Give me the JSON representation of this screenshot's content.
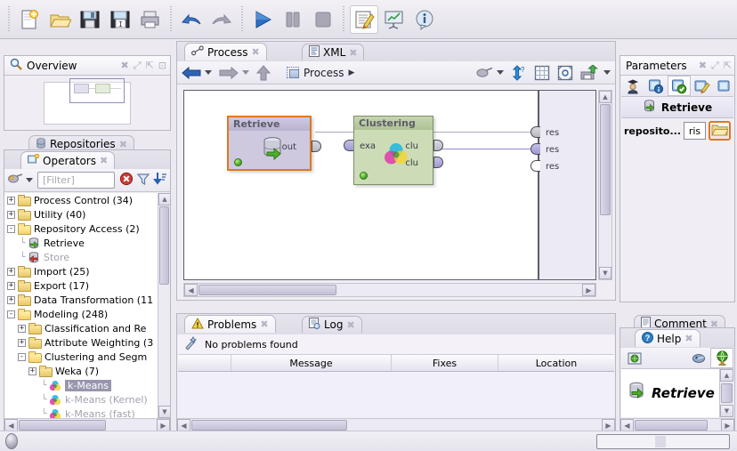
{
  "toolbar": {
    "groups": [
      {
        "buttons": [
          {
            "name": "new-process-button",
            "icon": "new-document-icon",
            "label": "New"
          },
          {
            "name": "open-process-button",
            "icon": "open-folder-icon",
            "label": "Open"
          },
          {
            "name": "save-button",
            "icon": "save-disk-icon",
            "label": "Save"
          },
          {
            "name": "save-as-button",
            "icon": "save-as-disk-icon",
            "label": "Save As"
          },
          {
            "name": "print-button",
            "icon": "printer-icon",
            "label": "Print"
          }
        ]
      },
      {
        "buttons": [
          {
            "name": "undo-button",
            "icon": "undo-arrow-icon",
            "label": "Undo"
          },
          {
            "name": "redo-button",
            "icon": "redo-arrow-icon",
            "label": "Redo"
          }
        ]
      },
      {
        "buttons": [
          {
            "name": "run-button",
            "icon": "play-triangle-icon",
            "label": "Run"
          },
          {
            "name": "pause-button",
            "icon": "pause-bars-icon",
            "label": "Pause"
          },
          {
            "name": "stop-button",
            "icon": "stop-square-icon",
            "label": "Stop"
          }
        ]
      },
      {
        "buttons": [
          {
            "name": "design-perspective-button",
            "icon": "notepad-pencil-icon",
            "label": "Design",
            "selected": true
          },
          {
            "name": "results-perspective-button",
            "icon": "chart-easel-icon",
            "label": "Results",
            "selected": false
          },
          {
            "name": "info-button",
            "icon": "info-balloon-icon",
            "label": "Info",
            "selected": false
          }
        ]
      }
    ]
  },
  "overview": {
    "tab_label": "Overview",
    "icon": "magnifier-icon",
    "header_buttons": [
      "close-icon",
      "maximize-icon",
      "dock-icon",
      "restore-icon"
    ]
  },
  "repositories": {
    "tab_label": "Repositories",
    "icon": "database-icon",
    "close": "close-icon"
  },
  "operators": {
    "tab_label": "Operators",
    "icon": "operators-icon",
    "close": "close-icon",
    "filter_placeholder": "[Filter]",
    "filter_value": "",
    "toolbar_icons": [
      "operator-group-icon",
      "chevron-down-icon",
      "clear-filter-icon",
      "funnel-filter-icon",
      "sort-descending-icon"
    ],
    "tree": [
      {
        "label": "Process Control (34)",
        "depth": 0,
        "type": "folder",
        "toggle": "+"
      },
      {
        "label": "Utility (40)",
        "depth": 0,
        "type": "folder",
        "toggle": "+"
      },
      {
        "label": "Repository Access (2)",
        "depth": 0,
        "type": "folder-open",
        "toggle": "-"
      },
      {
        "label": "Retrieve",
        "depth": 1,
        "type": "operator-retrieve",
        "toggle": ""
      },
      {
        "label": "Store",
        "depth": 1,
        "type": "operator-store",
        "toggle": "",
        "dim": true
      },
      {
        "label": "Import (25)",
        "depth": 0,
        "type": "folder",
        "toggle": "+"
      },
      {
        "label": "Export (17)",
        "depth": 0,
        "type": "folder",
        "toggle": "+"
      },
      {
        "label": "Data Transformation (11",
        "depth": 0,
        "type": "folder",
        "toggle": "+"
      },
      {
        "label": "Modeling (248)",
        "depth": 0,
        "type": "folder-open",
        "toggle": "-"
      },
      {
        "label": "Classification and Re",
        "depth": 1,
        "type": "folder",
        "toggle": "+"
      },
      {
        "label": "Attribute Weighting (3",
        "depth": 1,
        "type": "folder",
        "toggle": "+"
      },
      {
        "label": "Clustering and Segm",
        "depth": 1,
        "type": "folder-open",
        "toggle": "-"
      },
      {
        "label": "Weka (7)",
        "depth": 2,
        "type": "folder",
        "toggle": "+"
      },
      {
        "label": "k-Means",
        "depth": 3,
        "type": "operator-kmeans",
        "toggle": "",
        "selected": true
      },
      {
        "label": "k-Means (Kernel)",
        "depth": 3,
        "type": "operator-kmeans",
        "toggle": "",
        "dim": true
      },
      {
        "label": "k-Means (fast)",
        "depth": 3,
        "type": "operator-kmeans",
        "toggle": "",
        "dim": true
      }
    ]
  },
  "process": {
    "tabs": [
      {
        "label": "Process",
        "icon": "process-link-icon",
        "active": true,
        "close": "close-icon"
      },
      {
        "label": "XML",
        "icon": "xml-document-icon",
        "active": false,
        "close": "close-icon"
      }
    ],
    "toolbar": {
      "back_icon": "back-arrow-icon",
      "back_caret": "chevron-down-icon",
      "forward_icon": "forward-arrow-icon",
      "forward_caret": "chevron-down-icon",
      "up_icon": "up-arrow-icon",
      "breadcrumb_icon": "process-root-icon",
      "breadcrumb_label": "Process",
      "breadcrumb_caret": "chevron-right-icon",
      "right_icons": [
        "filter-view-icon",
        "chevron-down-icon",
        "auto-layout-icon",
        "grid-icon",
        "fit-to-screen-icon",
        "export-image-icon",
        "chevron-down-icon"
      ]
    },
    "operators": [
      {
        "name": "Retrieve",
        "selected": true,
        "icon": "retrieve-database-icon",
        "status": "ready",
        "header_color": "#bfb9d4",
        "body_color": "#cfc9e0",
        "border_color": "#e07820",
        "output_ports": [
          {
            "label": "out",
            "state": "gray"
          }
        ],
        "input_ports": []
      },
      {
        "name": "Clustering",
        "selected": false,
        "icon": "kmeans-cluster-icon",
        "status": "ready",
        "header_color": "#b9c9a4",
        "body_color": "#cbdcb6",
        "border_color": "#7e8f68",
        "input_ports": [
          {
            "label": "exa",
            "state": "violet"
          }
        ],
        "output_ports": [
          {
            "label": "clu",
            "state": "gray"
          },
          {
            "label": "clu",
            "state": "violet"
          }
        ]
      }
    ],
    "result_ports": [
      {
        "label": "res",
        "state": "gray"
      },
      {
        "label": "res",
        "state": "violet"
      },
      {
        "label": "res",
        "state": "empty"
      }
    ]
  },
  "problems": {
    "tabs": [
      {
        "label": "Problems",
        "icon": "warning-triangle-icon",
        "active": true,
        "close": "close-icon"
      },
      {
        "label": "Log",
        "icon": "log-document-icon",
        "active": false,
        "close": "close-icon"
      }
    ],
    "status_icon": "quickfix-wand-icon",
    "status_text": "No problems found",
    "columns": [
      "Message",
      "Fixes",
      "Location"
    ],
    "rows": []
  },
  "parameters": {
    "tab_label": "Parameters",
    "icon": "parameters-icon",
    "header_buttons": [
      "close-icon",
      "maximize-icon",
      "dock-icon"
    ],
    "mode_icons": [
      {
        "name": "expert-mode-icon",
        "selected": false
      },
      {
        "name": "info-blue-icon",
        "selected": false
      },
      {
        "name": "validate-check-icon",
        "selected": true
      },
      {
        "name": "edit-pencil-icon",
        "selected": false
      },
      {
        "name": "extra-panel-icon",
        "selected": false
      }
    ],
    "operator_icon": "retrieve-database-icon",
    "operator_name": "Retrieve",
    "rows": [
      {
        "label": "reposito...",
        "value": "ris",
        "button_icon": "open-folder-icon",
        "button_highlight": "#e07820"
      }
    ]
  },
  "comment": {
    "tab_label": "Comment",
    "icon": "comment-document-icon",
    "close": "close-icon"
  },
  "help": {
    "tab_label": "Help",
    "icon": "help-question-icon",
    "close": "close-icon",
    "toolbar_icons": [
      {
        "name": "help-local-icon",
        "selected": false
      },
      {
        "name": "help-wiki-icon",
        "selected": false
      },
      {
        "name": "help-globe-icon",
        "selected": true
      }
    ],
    "entry_icon": "retrieve-database-icon",
    "entry_title": "Retrieve"
  },
  "statusbar": {
    "led_name": "status-led",
    "progress_value": ""
  },
  "colors": {
    "accent_orange": "#e07820",
    "panel_bg": "#f0eef4",
    "chrome_bg": "#eceaf0",
    "selection": "#9896ad",
    "port_violet": "#9e9ad4",
    "led_green": "#3f9e22"
  }
}
